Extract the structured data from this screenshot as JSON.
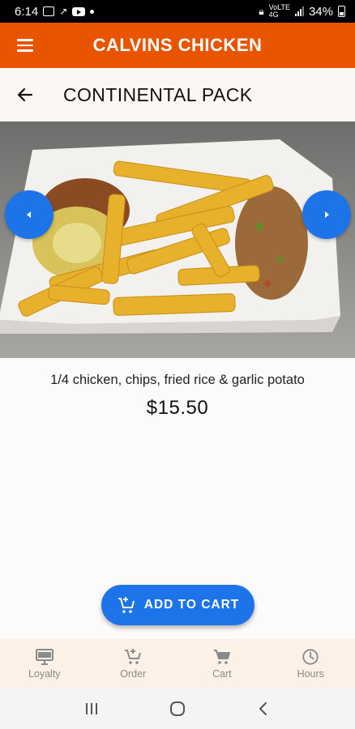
{
  "status_bar": {
    "time": "6:14",
    "signal_text_top": "VoLTE",
    "signal_text_bottom": "4G",
    "battery": "34%"
  },
  "app_bar": {
    "title": "CALVINS CHICKEN"
  },
  "page": {
    "title": "CONTINENTAL PACK"
  },
  "product": {
    "description": "1/4 chicken, chips, fried rice & garlic potato",
    "price": "$15.50",
    "image_alt": "Food tray with chips, chicken, rice and potato"
  },
  "actions": {
    "add_to_cart_label": "ADD TO CART"
  },
  "bottom_nav": {
    "items": [
      {
        "label": "Loyalty",
        "icon": "monitor-icon"
      },
      {
        "label": "Order",
        "icon": "add-cart-icon"
      },
      {
        "label": "Cart",
        "icon": "cart-icon"
      },
      {
        "label": "Hours",
        "icon": "clock-icon"
      }
    ]
  },
  "colors": {
    "brand": "#e85400",
    "accent": "#1d73e8",
    "nav_bg": "#fbf1e6"
  }
}
